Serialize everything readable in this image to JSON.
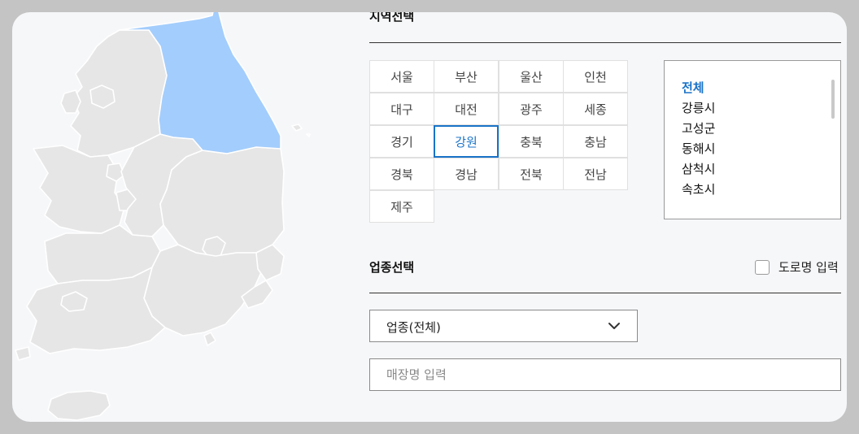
{
  "region_section": {
    "title": "지역선택",
    "regions": [
      "서울",
      "부산",
      "울산",
      "인천",
      "대구",
      "대전",
      "광주",
      "세종",
      "경기",
      "강원",
      "충북",
      "충남",
      "경북",
      "경남",
      "전북",
      "전남",
      "제주"
    ],
    "selected_region": "강원",
    "cities": [
      "전체",
      "강릉시",
      "고성군",
      "동해시",
      "삼척시",
      "속초시"
    ],
    "selected_city": "전체"
  },
  "business_section": {
    "title": "업종선택",
    "road_name_label": "도로명 입력",
    "category_select": "업종(전체)",
    "store_placeholder": "매장명 입력"
  },
  "map": {
    "highlighted_region": "강원",
    "highlight_color": "#a3cdfc",
    "land_color": "#e6e6e6",
    "border_color": "#ffffff"
  },
  "colors": {
    "accent": "#1a73c8"
  }
}
